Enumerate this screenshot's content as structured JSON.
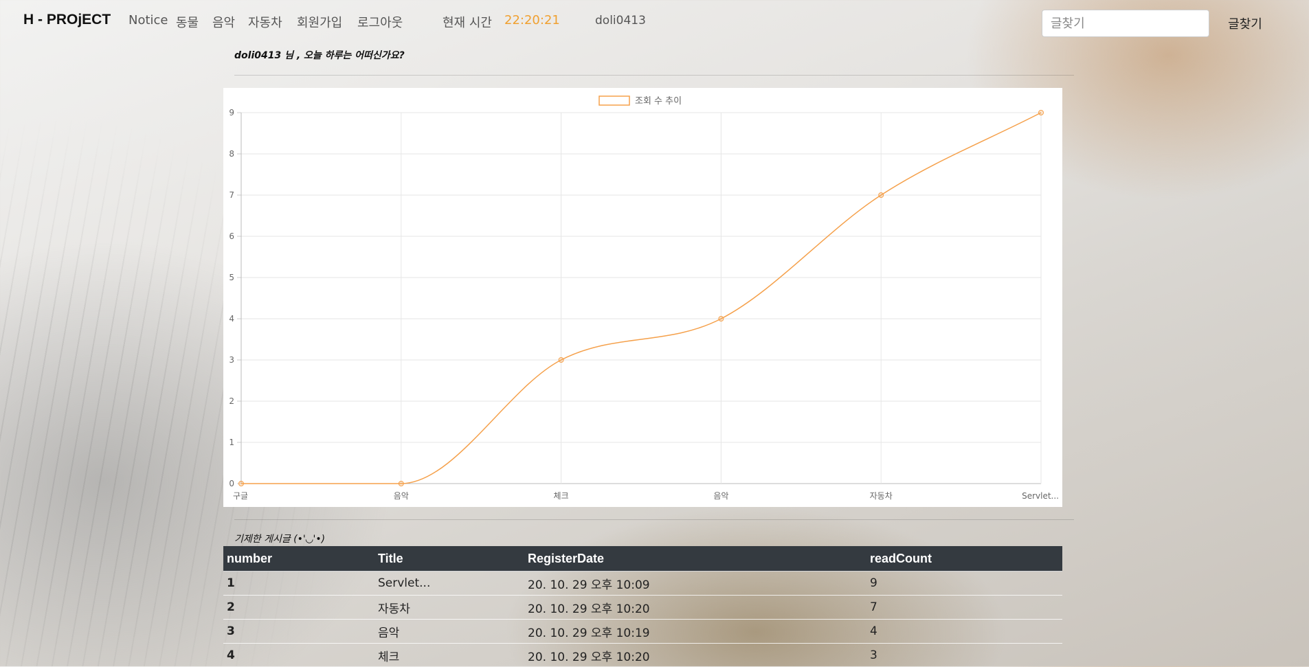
{
  "navbar": {
    "brand": "H - PROjECT",
    "links": [
      "Notice",
      "동물",
      "음악",
      "자동차",
      "회원가입",
      "로그아웃"
    ],
    "time_label": "현재 시간",
    "time_value": "22:20:21",
    "username": "doli0413",
    "search_placeholder": "글찾기",
    "search_button": "글찾기"
  },
  "greeting": "doli0413 님 , 오늘 하루는 어떠신가요?",
  "section_title": "기제한 게시글 (•'◡'•)",
  "colors": {
    "accent": "#f0a030",
    "table_header": "#343a40"
  },
  "chart_data": {
    "type": "line",
    "categories": [
      "구글",
      "음악",
      "체크",
      "음악",
      "자동차",
      "Servlet..."
    ],
    "series": [
      {
        "name": "조회 수 추이",
        "values": [
          0,
          0,
          3,
          4,
          7,
          9
        ]
      }
    ],
    "ylim": [
      0,
      9
    ],
    "yticks": [
      0,
      1,
      2,
      3,
      4,
      5,
      6,
      7,
      8,
      9
    ],
    "legend": "top-center",
    "grid": true,
    "color": "#f5a04a"
  },
  "table": {
    "headers": [
      "number",
      "Title",
      "RegisterDate",
      "readCount"
    ],
    "rows": [
      [
        "1",
        "Servlet...",
        "20. 10. 29 오후 10:09",
        "9"
      ],
      [
        "2",
        "자동차",
        "20. 10. 29 오후 10:20",
        "7"
      ],
      [
        "3",
        "음악",
        "20. 10. 29 오후 10:19",
        "4"
      ],
      [
        "4",
        "체크",
        "20. 10. 29 오후 10:20",
        "3"
      ]
    ]
  }
}
